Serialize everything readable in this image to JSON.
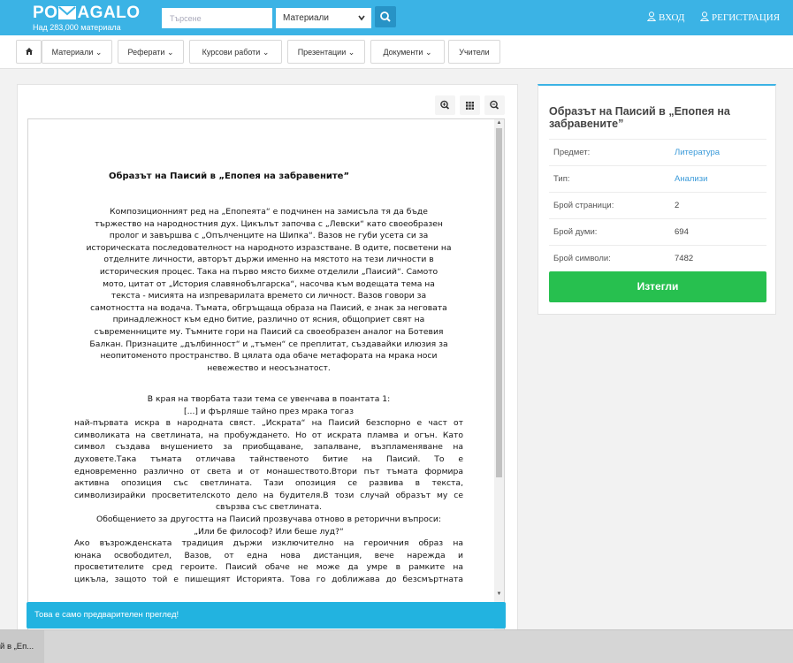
{
  "header": {
    "logo_text": "POMAGALO",
    "logo_sub": "Над 283,000 материала",
    "search_placeholder": "Търсене",
    "search_select": "Материали",
    "login": "ВХОД",
    "register": "РЕГИСТРАЦИЯ"
  },
  "nav": {
    "items": [
      "Материали",
      "Реферати",
      "Курсови работи",
      "Презентации",
      "Документи",
      "Учители"
    ]
  },
  "document": {
    "title": "Образът на Паисий в „Епопея на забравените”",
    "p1": [
      "Композиционният ред на „Епопеята“ е подчинен на замисъла тя да бъде",
      "тържество на народностния дух. Цикълът започва с „Левски“ като своеобразен",
      "пролог и завършва с „Опълченците на Шипка“. Вазов не губи усета си за",
      "историческата последователност на народното изразстване. В одите, посветени на",
      "отделните личности, авторът държи именно на мястото на тези личности в",
      "историческия процес. Така на първо място бихме отделили „Паисий“. Самото",
      "мото, цитат от „История славянобългарска“, насочва към водещата тема на",
      "текста - мисията на изпреварилата времето си личност. Вазов говори за",
      "самотността на водача. Тъмата, обгръщаща образа на Паисий, е знак за неговата",
      "принадлежност към едно битие, различно от ясния, общоприет свят на",
      "съвременниците му. Тъмните гори на Паисий са своеобразен аналог на Ботевия",
      "Балкан. Признаците „дълбинност“ и „тъмен“ се преплитат, създавайки илюзия за",
      "неопитоменото пространство. В цялата ода обаче метафората на мрака носи",
      "невежество и неосъзнатост."
    ],
    "p2_center": [
      "В края на творбата тази тема се увенчава в поантата 1:",
      "[...] и фърляше тайно през мрака тогаз"
    ],
    "p2_just": [
      "най-първата искра в народната свяст. „Искрата“ на Паисий безспорно е част от",
      "символиката на светлината, на пробуждането. Но от искрата пламва и огън. Като",
      "символ създава внушението за приобщаване, запалване, възпламеняване на",
      "духовете.Така тъмата отличава тайнственото битие на Паисий. То е",
      "едновременно различно от света и от монашеството.Втори път тъмата формира",
      "активна опозиция със светлината. Тази опозиция се развива в текста,",
      "символизирайки просветителското дело на будителя.В този случай образът му се"
    ],
    "p2_tail": [
      "свързва със светлината.",
      "Обобщението за другостта на Паисий прозвучава отново в реторични въпроси:",
      "„Или бе философ? Или беше луд?“"
    ],
    "p3_just": [
      "Ако възрожденската традиция държи изключително на героичния образ на",
      "юнака освободител, Вазов, от една нова дистанция, вече нарежда и",
      "просветителите сред героите. Паисий обаче не може да умре в рамките на",
      "цикъла, защото той е пишещият Историята. Това го доближава до безсмъртната"
    ]
  },
  "preview_notice": "Това е само предварителен преглед!",
  "info": {
    "title": "Образът на Паисий в „Епопея на забравените”",
    "rows": [
      {
        "key": "Предмет:",
        "value": "Литература"
      },
      {
        "key": "Тип:",
        "value": "Анализи"
      },
      {
        "key": "Брой страници:",
        "value": "2"
      },
      {
        "key": "Брой думи:",
        "value": "694"
      },
      {
        "key": "Брой символи:",
        "value": "7482"
      }
    ],
    "download": "Изтегли"
  },
  "taskbar": {
    "item": "й в „Еп..."
  },
  "colors": {
    "brand": "#3bb3e5",
    "download": "#27c04f",
    "link": "#3a9ad9",
    "notice": "#22b3e0"
  }
}
